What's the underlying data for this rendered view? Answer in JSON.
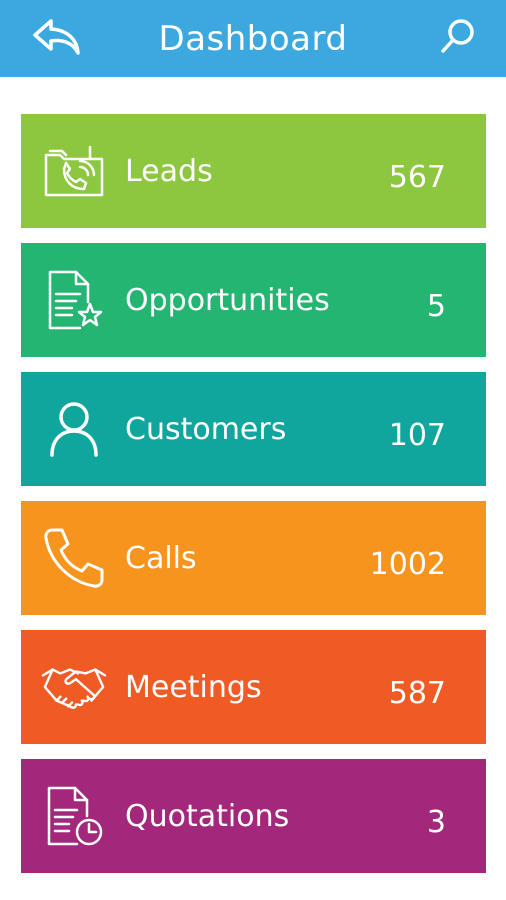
{
  "header": {
    "title": "Dashboard",
    "back_icon": "back-arrow-icon",
    "search_icon": "search-icon",
    "color": "#3ba9e0"
  },
  "tiles": [
    {
      "label": "Leads",
      "count": "567",
      "color": "#8dc63f",
      "icon": "lead-call-icon"
    },
    {
      "label": "Opportunities",
      "count": "5",
      "color": "#25b573",
      "icon": "document-star-icon"
    },
    {
      "label": "Customers",
      "count": "107",
      "color": "#10a69e",
      "icon": "person-icon"
    },
    {
      "label": "Calls",
      "count": "1002",
      "color": "#f7941d",
      "icon": "phone-icon"
    },
    {
      "label": "Meetings",
      "count": "587",
      "color": "#f05a24",
      "icon": "handshake-icon"
    },
    {
      "label": "Quotations",
      "count": "3",
      "color": "#a3287c",
      "icon": "document-clock-icon"
    }
  ]
}
